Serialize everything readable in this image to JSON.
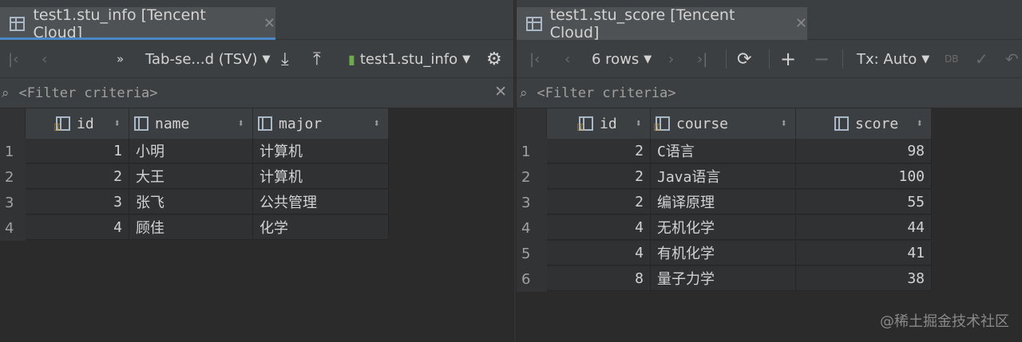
{
  "left": {
    "tab": {
      "title": "test1.stu_info [Tencent Cloud]",
      "close": "✕"
    },
    "toolbar": {
      "format_label": "Tab-se...d (TSV)",
      "table_label": "test1.stu_info"
    },
    "filter": {
      "placeholder": "<Filter criteria>"
    },
    "columns": [
      "id",
      "name",
      "major"
    ],
    "rows": [
      {
        "num": "1",
        "id": "1",
        "name": "小明",
        "major": "计算机"
      },
      {
        "num": "2",
        "id": "2",
        "name": "大王",
        "major": "计算机"
      },
      {
        "num": "3",
        "id": "3",
        "name": "张飞",
        "major": "公共管理"
      },
      {
        "num": "4",
        "id": "4",
        "name": "顾佳",
        "major": "化学"
      }
    ]
  },
  "right": {
    "tab": {
      "title": "test1.stu_score [Tencent Cloud]",
      "close": "✕"
    },
    "toolbar": {
      "rows_label": "6 rows",
      "tx_label": "Tx: Auto"
    },
    "filter": {
      "placeholder": "<Filter criteria>"
    },
    "columns": [
      "id",
      "course",
      "score"
    ],
    "rows": [
      {
        "num": "1",
        "id": "2",
        "course": "C语言",
        "score": "98"
      },
      {
        "num": "2",
        "id": "2",
        "course": "Java语言",
        "score": "100"
      },
      {
        "num": "3",
        "id": "2",
        "course": "编译原理",
        "score": "55"
      },
      {
        "num": "4",
        "id": "4",
        "course": "无机化学",
        "score": "44"
      },
      {
        "num": "5",
        "id": "4",
        "course": "有机化学",
        "score": "41"
      },
      {
        "num": "6",
        "id": "8",
        "course": "量子力学",
        "score": "38"
      }
    ]
  },
  "watermark": "@稀土掘金技术社区",
  "colors": {
    "accent": "#4a88c7",
    "background": "#2b2b2b",
    "toolbar": "#3c3f41"
  }
}
